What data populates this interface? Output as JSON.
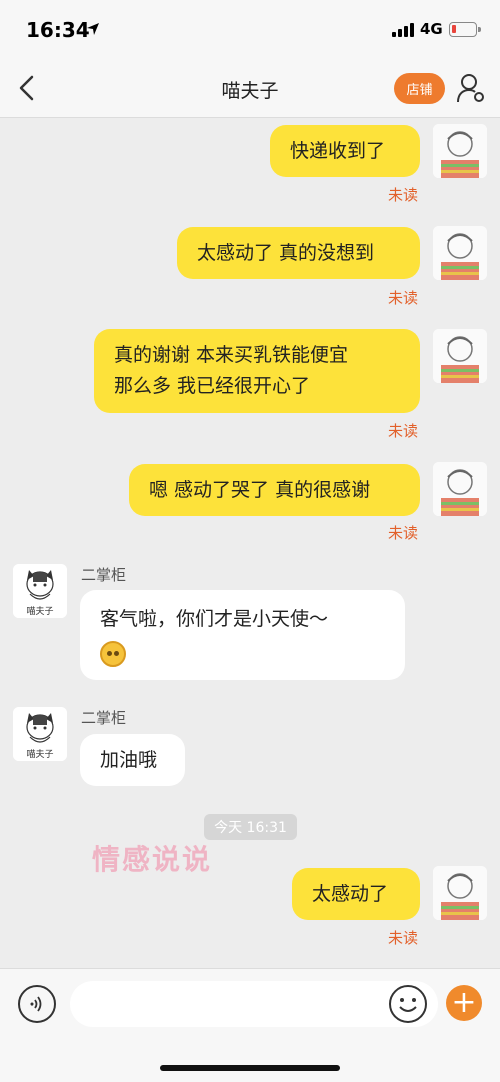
{
  "status_bar": {
    "time": "16:34",
    "network": "4G"
  },
  "header": {
    "title": "喵夫子",
    "shop_label": "店铺"
  },
  "messages": [
    {
      "text": "快递收到了",
      "status": "未读"
    },
    {
      "text": "太感动了 真的没想到",
      "status": "未读"
    },
    {
      "line1": "真的谢谢 本来买乳铁能便宜",
      "line2": "那么多 我已经很开心了",
      "status": "未读"
    },
    {
      "text": "嗯 感动了哭了 真的很感谢",
      "status": "未读"
    },
    {
      "sender": "二掌柜",
      "text": "客气啦，你们才是小天使～"
    },
    {
      "sender": "二掌柜",
      "text": "加油哦"
    },
    {
      "text": "太感动了",
      "status": "未读"
    }
  ],
  "time_divider": "今天 16:31",
  "watermark": "情感说说",
  "shop_avatar_text": "喵夫子",
  "input": {
    "placeholder": ""
  },
  "icons": {
    "back": "chevron-left-icon",
    "person": "person-settings-icon",
    "voice": "voice-icon",
    "emoji": "emoji-icon",
    "plus": "plus-icon"
  },
  "colors": {
    "accent": "#ee7b2e",
    "my_bubble": "#fde23a",
    "unread": "#e2602a"
  }
}
